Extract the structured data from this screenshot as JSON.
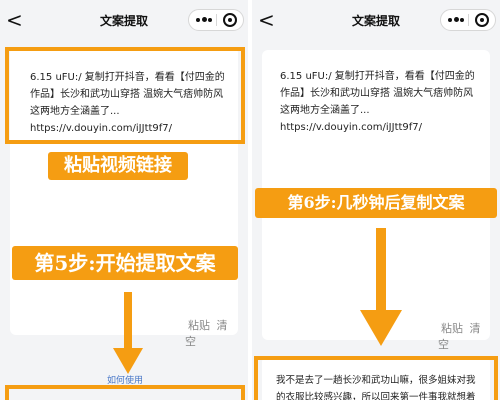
{
  "left": {
    "nav_title": "文案提取",
    "video_link": "6.15 uFU:/ 复制打开抖音，看看【付四金的作品】长沙和武功山穿搭 温婉大气痞帅防风这两地方全涵盖了... https://v.douyin.com/iJJtt9f7/",
    "annotation_paste": "粘贴视频链接",
    "annotation_step5": "第5步:开始提取文案",
    "actions": {
      "paste": "粘贴",
      "clear": "清空"
    },
    "help_link": "如何使用"
  },
  "right": {
    "nav_title": "文案提取",
    "video_link": "6.15 uFU:/ 复制打开抖音，看看【付四金的作品】长沙和武功山穿搭 温婉大气痞帅防风这两地方全涵盖了... https://v.douyin.com/iJJtt9f7/",
    "annotation_step6": "第6步:几秒钟后复制文案",
    "actions": {
      "paste": "粘贴",
      "clear": "清空"
    },
    "result_text": "我不是去了一趟长沙和武功山嘛，很多姐妹对我的衣服比较感兴趣，所以回来第一件事我就想着"
  },
  "colors": {
    "accent": "#f59d12",
    "link": "#4a78c8",
    "background": "#f3f4f6"
  },
  "icons": [
    "back-icon",
    "more-dots-icon",
    "target-icon",
    "down-arrow-icon"
  ]
}
